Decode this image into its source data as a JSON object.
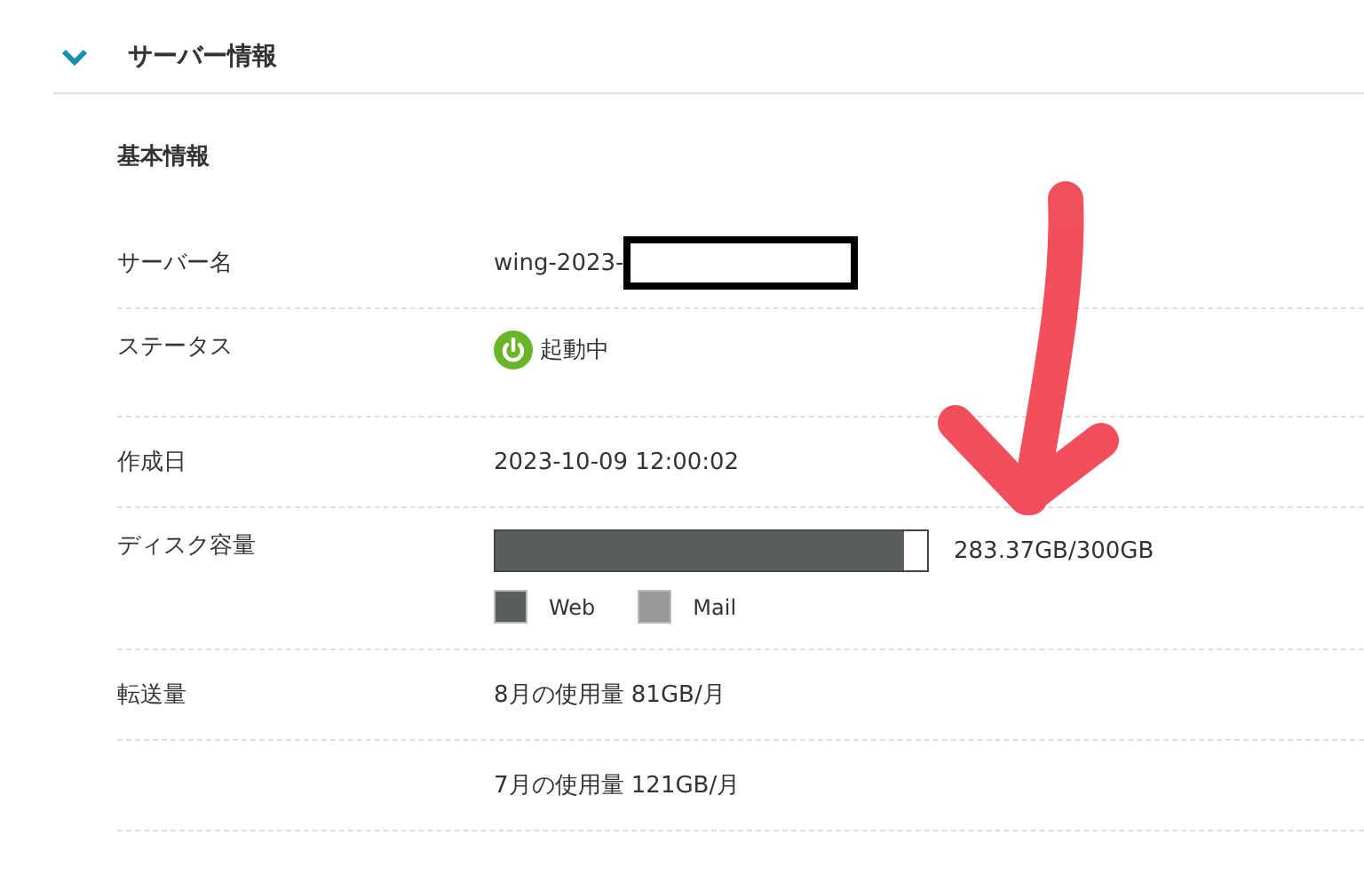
{
  "section": {
    "title": "サーバー情報",
    "expanded": true
  },
  "subsection_title": "基本情報",
  "rows": [
    {
      "kind": "text",
      "label": "サーバー名",
      "value": "wing-2023-",
      "redacted": true
    },
    {
      "kind": "status",
      "label": "ステータス",
      "value": "起動中"
    },
    {
      "kind": "text",
      "label": "作成日",
      "value": "2023-10-09 12:00:02"
    },
    {
      "kind": "disk",
      "label": "ディスク容量",
      "level": 0.945,
      "value": "283.37GB/300GB",
      "legend": [
        {
          "label": "Web",
          "color": "#5a5e5f"
        },
        {
          "label": "Mail",
          "color": "#999999"
        }
      ]
    },
    {
      "kind": "text",
      "label": "転送量",
      "value": "8月の使用量 81GB/月"
    },
    {
      "kind": "text",
      "value": "7月の使用量 121GB/月"
    }
  ]
}
